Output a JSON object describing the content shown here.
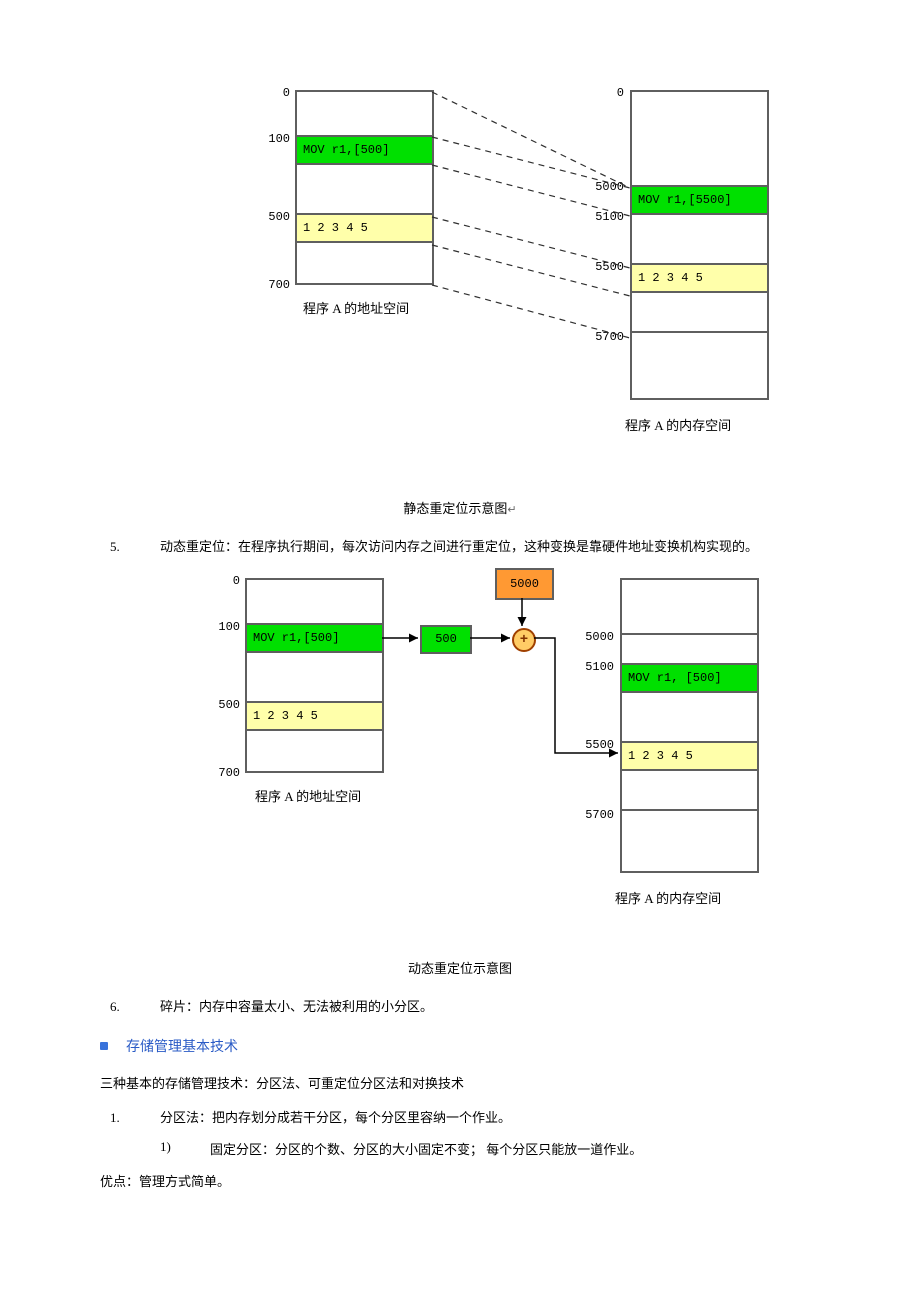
{
  "diag1": {
    "left_ticks": {
      "t0": "0",
      "t100": "100",
      "t500": "500",
      "t700": "700"
    },
    "right_ticks": {
      "t0": "0",
      "t5000": "5000",
      "t5100": "5100",
      "t5500": "5500",
      "t5700": "5700"
    },
    "left_mov": "MOV r1,[500]",
    "left_data": "1 2 3 4 5",
    "right_mov": "MOV r1,[5500]",
    "right_data": "1 2 3 4 5",
    "left_caption": "程序 A 的地址空间",
    "right_caption": "程序 A 的内存空间",
    "figure_caption": "静态重定位示意图"
  },
  "item5": {
    "num": "5.",
    "text": "动态重定位：在程序执行期间，每次访问内存之间进行重定位，这种变换是靠硬件地址变换机构实现的。"
  },
  "diag2": {
    "left_ticks": {
      "t0": "0",
      "t100": "100",
      "t500": "500",
      "t700": "700"
    },
    "right_ticks": {
      "t5000": "5000",
      "t5100": "5100",
      "t5500": "5500",
      "t5700": "5700"
    },
    "left_mov": "MOV r1,[500]",
    "left_data": "1 2 3 4 5",
    "right_mov": "MOV r1, [500]",
    "right_data": "1 2 3 4 5",
    "addr_box": "500",
    "base_box": "5000",
    "adder": "+",
    "left_caption": "程序 A 的地址空间",
    "right_caption": "程序 A 的内存空间",
    "figure_caption": "动态重定位示意图"
  },
  "item6": {
    "num": "6.",
    "text": "碎片：内存中容量太小、无法被利用的小分区。"
  },
  "section_bullet": "存储管理基本技术",
  "intro_para": "三种基本的存储管理技术：分区法、可重定位分区法和对换技术",
  "item_part1": {
    "num": "1.",
    "text": "分区法：把内存划分成若干分区，每个分区里容纳一个作业。"
  },
  "item_part1_sub1": {
    "num": "1)",
    "text": "固定分区：分区的个数、分区的大小固定不变；  每个分区只能放一道作业。"
  },
  "advantage_para": "优点：管理方式简单。"
}
